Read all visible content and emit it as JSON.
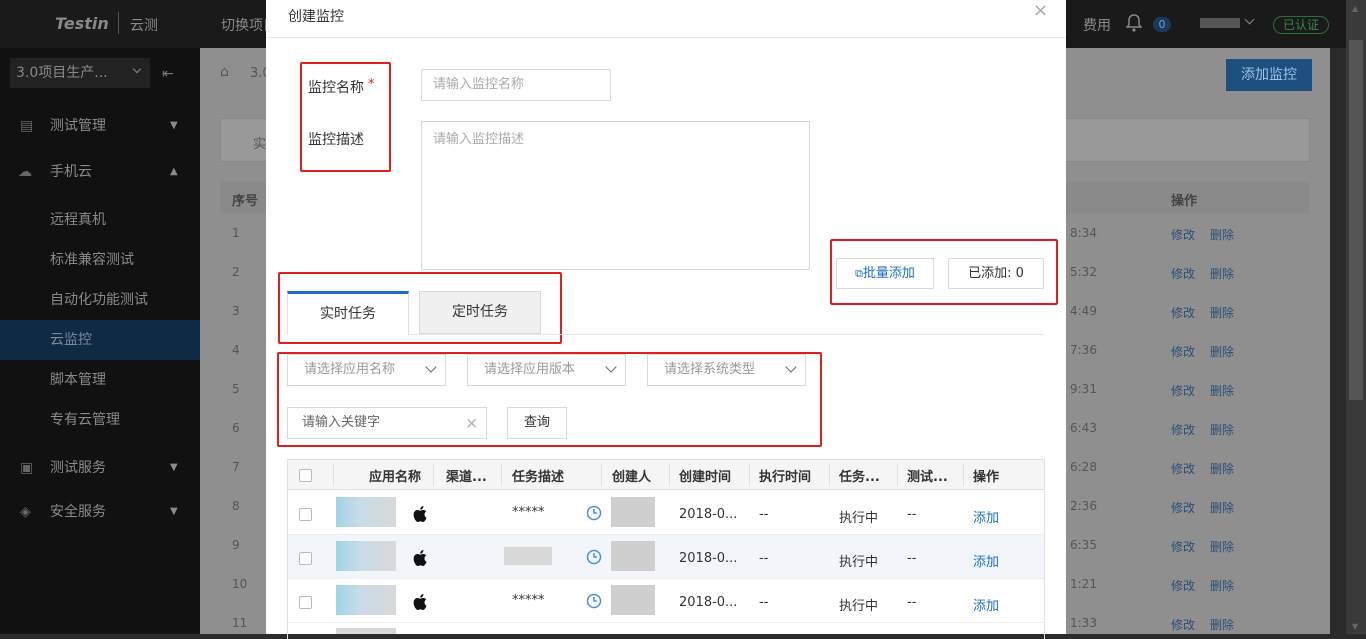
{
  "topbar": {
    "logo": "Testin",
    "logo_sub": "云测",
    "switch_project": "切换项目",
    "fee": "费用",
    "notif_count": "0",
    "verified": "已认证"
  },
  "sidebar": {
    "project": "3.0项目生产...",
    "items": [
      {
        "label": "测试管理"
      },
      {
        "label": "手机云"
      },
      {
        "label": "远程真机"
      },
      {
        "label": "标准兼容测试"
      },
      {
        "label": "自动化功能测试"
      },
      {
        "label": "云监控"
      },
      {
        "label": "脚本管理"
      },
      {
        "label": "专有云管理"
      },
      {
        "label": "测试服务"
      },
      {
        "label": "安全服务"
      }
    ]
  },
  "background": {
    "breadcrumb": "3.0",
    "tab_first": "实",
    "add_monitor": "添加监控",
    "col_seq": "序号",
    "col_ops": "操作",
    "rows": [
      {
        "seq": "1",
        "time": "8:34"
      },
      {
        "seq": "2",
        "time": "5:32"
      },
      {
        "seq": "3",
        "time": "4:49"
      },
      {
        "seq": "4",
        "time": "7:36"
      },
      {
        "seq": "5",
        "time": "9:31"
      },
      {
        "seq": "6",
        "time": "6:43"
      },
      {
        "seq": "7",
        "time": "6:28"
      },
      {
        "seq": "8",
        "time": "2:36"
      },
      {
        "seq": "9",
        "time": "6:35"
      },
      {
        "seq": "10",
        "time": "1:21"
      },
      {
        "seq": "11",
        "time": "1:33"
      }
    ],
    "edit": "修改",
    "delete": "删除"
  },
  "modal": {
    "title": "创建监控",
    "close": "×",
    "name_label": "监控名称",
    "required_mark": "*",
    "name_placeholder": "请输入监控名称",
    "desc_label": "监控描述",
    "desc_placeholder": "请输入监控描述",
    "batch_add": "批量添加",
    "added_label": "已添加:",
    "added_count": "0",
    "tabs": [
      "实时任务",
      "定时任务"
    ],
    "filter_app_name": "请选择应用名称",
    "filter_app_version": "请选择应用版本",
    "filter_os": "请选择系统类型",
    "keyword_placeholder": "请输入关键字",
    "query": "查询",
    "table": {
      "headers": [
        "应用名称",
        "渠道...",
        "任务描述",
        "创建人",
        "创建时间",
        "执行时间",
        "任务...",
        "测试...",
        "操作"
      ],
      "rows": [
        {
          "desc": "*****",
          "created": "2018-0...",
          "exec": "--",
          "status": "执行中",
          "test": "--",
          "action": "添加"
        },
        {
          "desc": "",
          "created": "2018-0...",
          "exec": "--",
          "status": "执行中",
          "test": "--",
          "action": "添加"
        },
        {
          "desc": "*****",
          "created": "2018-0...",
          "exec": "--",
          "status": "执行中",
          "test": "--",
          "action": "添加"
        }
      ]
    }
  }
}
